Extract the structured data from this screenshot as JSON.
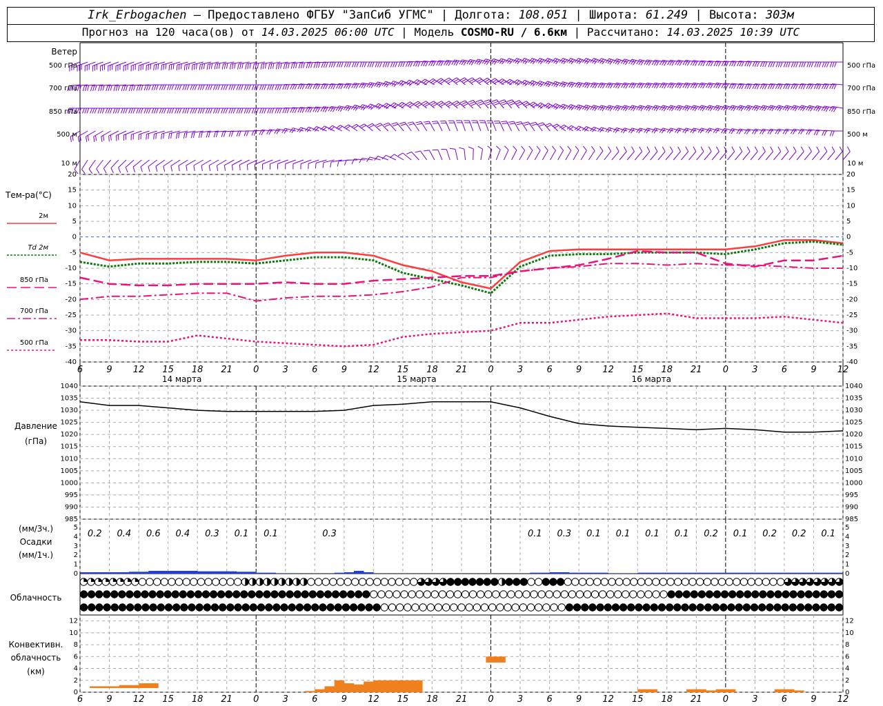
{
  "header": {
    "station": "Irk_Erbogachen",
    "provider": "– Предоставлено ФГБУ \"ЗапСиб УГМС\"",
    "lon_label": "Долгота:",
    "lon": "108.051",
    "lat_label": "Широта:",
    "lat": "61.249",
    "alt_label": "Высота:",
    "alt": "303м",
    "forecast_prefix": "Прогноз на 120 часа(ов) от",
    "forecast_start": "14.03.2025 06:00 UTC",
    "model_label": "Модель",
    "model": "COSMO-RU / 6.6км",
    "calc_label": "Рассчитано:",
    "calc_time": "14.03.2025 10:39 UTC"
  },
  "colors": {
    "wind": "#7b00d6",
    "t2m": "#ff3c3c",
    "td2m": "#0a7a0a",
    "t850": "#e8147a",
    "t700": "#e8147a",
    "t500": "#e8147a",
    "pressure": "#000000",
    "precip": "#1f3fd6",
    "convective": "#f07f1d",
    "zero_line": "#3060ff"
  },
  "panels": {
    "wind": {
      "title": "Ветер",
      "levels": [
        "500 гПа",
        "700 гПа",
        "850 гПа",
        "500 м",
        "10  м"
      ]
    },
    "temperature": {
      "title": "Тем-ра(°C)",
      "legend": [
        "2м",
        "Td  2м",
        "850 гПа",
        "700 гПа",
        "500 гПа"
      ]
    },
    "pressure": {
      "title_1": "Давление",
      "title_2": "(гПа)"
    },
    "precip": {
      "title_1": "(мм/3ч.)",
      "title_2": "Осадки",
      "title_3": "(мм/1ч.)"
    },
    "clouds": {
      "title": "Облачность"
    },
    "convective": {
      "title_1": "Конвективн.",
      "title_2": "облачность",
      "title_3": "(км)"
    }
  },
  "chart_data": [
    {
      "type": "line",
      "name": "temperature",
      "x_hours": [
        0,
        3,
        6,
        9,
        12,
        15,
        18,
        21,
        24,
        27,
        30,
        33,
        36,
        39,
        42,
        45,
        48,
        51,
        54,
        57,
        60,
        63,
        66,
        69,
        72,
        75,
        78
      ],
      "x_tick_labels": [
        "6",
        "9",
        "12",
        "15",
        "18",
        "21",
        "0",
        "3",
        "6",
        "9",
        "12",
        "15",
        "18",
        "21",
        "0",
        "3",
        "6",
        "9",
        "12",
        "15",
        "18",
        "21",
        "0",
        "3",
        "6",
        "9",
        "12"
      ],
      "day_labels": [
        "14 марта",
        "15 марта",
        "16 марта"
      ],
      "ylim": [
        -40,
        20
      ],
      "yticks": [
        20,
        15,
        10,
        5,
        0,
        -5,
        -10,
        -15,
        -20,
        -25,
        -30,
        -35,
        -40
      ],
      "series": [
        {
          "name": "2м",
          "values": [
            -5,
            -7.5,
            -7,
            -7,
            -7,
            -7,
            -7.5,
            -6,
            -5,
            -5,
            -6,
            -9,
            -11,
            -14.5,
            -16.5,
            -8,
            -4.5,
            -4,
            -4,
            -4,
            -4,
            -4,
            -4,
            -3,
            -1,
            -1,
            -2
          ]
        },
        {
          "name": "Td 2м",
          "values": [
            -8,
            -9.5,
            -8.5,
            -8.5,
            -8,
            -8,
            -8.5,
            -7.5,
            -6.5,
            -6.5,
            -7.5,
            -11.5,
            -13.5,
            -15.5,
            -18,
            -9.5,
            -6,
            -5.5,
            -5.5,
            -5,
            -5,
            -5,
            -5.5,
            -4,
            -2,
            -1.5,
            -2.5
          ]
        },
        {
          "name": "850 гПа",
          "values": [
            -13,
            -15,
            -15.5,
            -15.5,
            -15,
            -15,
            -15,
            -14.5,
            -15,
            -15,
            -14,
            -13.5,
            -13,
            -12.5,
            -12.5,
            -11,
            -10,
            -9,
            -7,
            -4.5,
            -5,
            -5,
            -8.5,
            -9.5,
            -7.5,
            -7.5,
            -6
          ]
        },
        {
          "name": "700 гПа",
          "values": [
            -20,
            -19,
            -19,
            -18.5,
            -18,
            -18,
            -20.5,
            -19.5,
            -19,
            -19,
            -18.5,
            -17.5,
            -16,
            -13,
            -13,
            -11,
            -10,
            -9.5,
            -8.5,
            -8.5,
            -9,
            -8.5,
            -9,
            -9,
            -9.5,
            -10,
            -10
          ]
        },
        {
          "name": "500 гПа",
          "values": [
            -33,
            -33,
            -33.5,
            -33.5,
            -31.5,
            -32.5,
            -33.5,
            -34,
            -34.5,
            -35,
            -34.5,
            -32,
            -31,
            -30.5,
            -30,
            -27.5,
            -27.5,
            -26.5,
            -25.5,
            -25,
            -24.5,
            -26,
            -26,
            -26,
            -25.5,
            -26.5,
            -27.5
          ]
        }
      ]
    },
    {
      "type": "line",
      "name": "pressure",
      "x_hours": [
        0,
        3,
        6,
        9,
        12,
        15,
        18,
        21,
        24,
        27,
        30,
        33,
        36,
        39,
        42,
        45,
        48,
        51,
        54,
        57,
        60,
        63,
        66,
        69,
        72,
        75,
        78
      ],
      "ylim": [
        985,
        1040
      ],
      "yticks": [
        1040,
        1035,
        1030,
        1025,
        1020,
        1015,
        1010,
        1005,
        1000,
        995,
        990,
        985
      ],
      "series": [
        {
          "name": "Давление",
          "values": [
            1033.5,
            1032,
            1032,
            1031,
            1030,
            1029.5,
            1029.5,
            1029.5,
            1029.5,
            1030,
            1032,
            1032.5,
            1033.5,
            1033.5,
            1033.5,
            1031,
            1027.5,
            1024.5,
            1023.5,
            1023,
            1022.5,
            1022,
            1022.5,
            1022,
            1021,
            1021,
            1021.5
          ]
        }
      ]
    },
    {
      "type": "bar",
      "name": "precipitation",
      "ylim": [
        0,
        5
      ],
      "yticks": [
        5,
        4,
        3,
        2,
        1,
        0
      ],
      "labels_3h": [
        {
          "hour": 1.5,
          "text": "0.2"
        },
        {
          "hour": 4.5,
          "text": "0.4"
        },
        {
          "hour": 7.5,
          "text": "0.6"
        },
        {
          "hour": 10.5,
          "text": "0.4"
        },
        {
          "hour": 13.5,
          "text": "0.3"
        },
        {
          "hour": 16.5,
          "text": "0.1"
        },
        {
          "hour": 19.5,
          "text": "0.1"
        },
        {
          "hour": 25.5,
          "text": "0.3"
        },
        {
          "hour": 46.5,
          "text": "0.1"
        },
        {
          "hour": 49.5,
          "text": "0.3"
        },
        {
          "hour": 52.5,
          "text": "0.1"
        },
        {
          "hour": 55.5,
          "text": "0.1"
        },
        {
          "hour": 58.5,
          "text": "0.1"
        },
        {
          "hour": 61.5,
          "text": "0.1"
        },
        {
          "hour": 64.5,
          "text": "0.2"
        },
        {
          "hour": 67.5,
          "text": "0.1"
        },
        {
          "hour": 70.5,
          "text": "0.2"
        },
        {
          "hour": 73.5,
          "text": "0.2"
        },
        {
          "hour": 76.5,
          "text": "0.1"
        }
      ],
      "hourly_mm": [
        0.15,
        0.15,
        0.15,
        0.15,
        0.15,
        0.2,
        0.2,
        0.3,
        0.3,
        0.3,
        0.3,
        0.3,
        0.25,
        0.25,
        0.25,
        0.25,
        0.2,
        0.2,
        0.1,
        0.1,
        0.05,
        0.05,
        0,
        0,
        0,
        0,
        0.1,
        0.15,
        0.3,
        0.15,
        0,
        0,
        0,
        0,
        0,
        0,
        0,
        0,
        0,
        0,
        0,
        0,
        0,
        0,
        0,
        0,
        0.1,
        0.1,
        0.15,
        0.15,
        0.1,
        0.1,
        0.1,
        0.1,
        0.05,
        0.05,
        0.05,
        0.1,
        0.1,
        0.1,
        0.1,
        0.1,
        0.1,
        0.1,
        0.1,
        0.1,
        0.1,
        0.1,
        0.1,
        0.1,
        0.1,
        0.1,
        0.1,
        0.1,
        0.1,
        0.1,
        0.1,
        0.1
      ]
    },
    {
      "type": "bar",
      "name": "convective_cloud",
      "ylim": [
        0,
        13
      ],
      "yticks": [
        12,
        10,
        8,
        6,
        4,
        2,
        0
      ],
      "hourly_top_km": [
        0,
        1,
        1,
        1,
        1.2,
        1.2,
        1.5,
        1.5,
        0,
        0,
        0,
        0,
        0,
        0,
        0,
        0,
        0,
        0,
        0,
        0,
        0,
        0,
        0,
        0.2,
        0.5,
        1,
        2,
        1.5,
        1.3,
        1.8,
        2,
        2,
        2,
        2,
        2,
        0,
        0,
        0,
        0,
        0,
        0,
        0,
        0,
        0,
        0,
        0,
        0,
        0,
        0,
        0,
        0,
        0,
        0,
        0,
        0,
        0,
        0,
        0.5,
        0.5,
        0,
        0,
        0,
        0.5,
        0.5,
        0.3,
        0.5,
        0.5,
        0,
        0,
        0,
        0,
        0.5,
        0.5,
        0.3,
        0,
        0,
        0,
        0
      ],
      "hourly_base_km": [
        0,
        0.7,
        0.7,
        0.7,
        0.7,
        0.7,
        0.7,
        0.7,
        0,
        0,
        0,
        0,
        0,
        0,
        0,
        0,
        0,
        0,
        0,
        0,
        0,
        0,
        0,
        0,
        0,
        0,
        0,
        0,
        0,
        0,
        0,
        0,
        0,
        0,
        0,
        0,
        0,
        0,
        0,
        0,
        0,
        0,
        0,
        0,
        0,
        0,
        0,
        0,
        0,
        0,
        0,
        0,
        0,
        0,
        0,
        0,
        0,
        0,
        0,
        0,
        0,
        0,
        0,
        0,
        0,
        0,
        0,
        0,
        0,
        0,
        0,
        0,
        0,
        0,
        0,
        0,
        0,
        0
      ],
      "cells": [
        {
          "hour": 42.5,
          "base_km": 5,
          "top_km": 6
        }
      ]
    }
  ],
  "cloud_rows": {
    "row1": "PPPPPPPPEEEEEEEEEEEEEEHHHHHHHHHEEEEEEEEEEEEEEEQQQQFFFFFFFHFFFEEFFFEEEEEEEEEEEEEEEEEEEEEEEEEEEEEEQQQQQQQQ",
    "row2": "FFFFFFFFFFFFFFFFFFFFFFFFFFFFFFFFFFFFFFEEEEEEEEEEEEEEEEEEEEEEEEEEEEEEEEEEEEEEEFFFFFFFFFFFFFFFFFFFFFFF",
    "row3": "FFFFFFFFFFFFFFFFFFFFFFFFFFFFFFFFFFFFFFFEEEEEEEEEEEEEEEEEEEEEEEEFFFFFFFFFFFFFFFFFFFFFFFFFFFFFFFFFFFF"
  },
  "wind_barbs": {
    "rows": [
      {
        "level": "500 гПа",
        "dir_deg": [
          250,
          250,
          250,
          255,
          255,
          260,
          260,
          260,
          265,
          270,
          270,
          270,
          275,
          280,
          285,
          290,
          290,
          290,
          290,
          285,
          280,
          280,
          275,
          275,
          270,
          270,
          270
        ]
      },
      {
        "level": "700 гПа",
        "dir_deg": [
          265,
          265,
          265,
          270,
          270,
          270,
          270,
          270,
          275,
          275,
          280,
          290,
          300,
          310,
          310,
          300,
          290,
          285,
          280,
          280,
          280,
          280,
          280,
          275,
          275,
          275,
          275
        ]
      },
      {
        "level": "850 гПа",
        "dir_deg": [
          270,
          270,
          270,
          270,
          270,
          270,
          270,
          270,
          275,
          280,
          290,
          300,
          310,
          310,
          320,
          320,
          300,
          290,
          285,
          285,
          285,
          285,
          285,
          285,
          285,
          285,
          280
        ]
      },
      {
        "level": "500 м",
        "dir_deg": [
          240,
          240,
          250,
          255,
          260,
          265,
          270,
          280,
          290,
          300,
          310,
          320,
          330,
          340,
          340,
          330,
          320,
          300,
          290,
          285,
          285,
          285,
          285,
          280,
          280,
          280,
          270
        ]
      },
      {
        "level": "10 м",
        "dir_deg": [
          210,
          220,
          230,
          235,
          240,
          240,
          245,
          250,
          250,
          260,
          280,
          300,
          330,
          350,
          20,
          30,
          30,
          30,
          40,
          40,
          40,
          40,
          40,
          40,
          40,
          40,
          40
        ]
      }
    ]
  }
}
